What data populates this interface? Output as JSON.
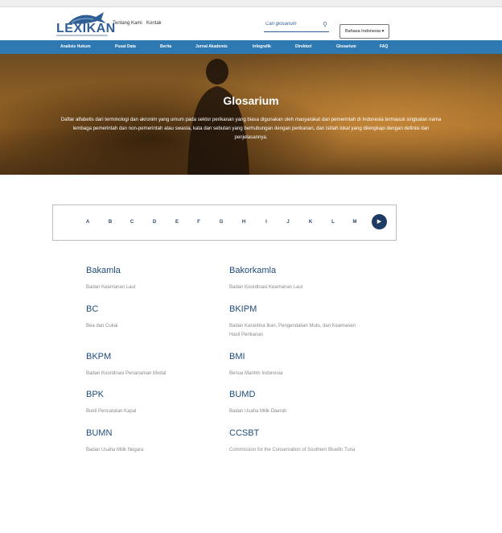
{
  "header": {
    "logo_text": "LEXIKAN",
    "links": [
      "Tentang Kami",
      "Kontak"
    ],
    "search_placeholder": "Cari glosarium",
    "language": "Bahasa Indonesia ▾"
  },
  "nav": {
    "items": [
      "Analisis Hukum",
      "Pusat Data",
      "Berita",
      "Jurnal Akademis",
      "Infografik",
      "Direktori",
      "Glosarium",
      "FAQ"
    ]
  },
  "hero": {
    "title": "Glosarium",
    "description": "Daftar alfabetis dari terminologi dan akronim yang umum pada sektor perikanan yang biasa digunakan oleh masyarakat dan pemerintah di Indonesia termasuk singkatan nama lembaga pemerintah dan non-pemerintah atau swasta, kata dan sebutan yang berhubungan dengan perikanan, dan istilah lokal yang dilengkapi dengan definisi dan penjelasannya."
  },
  "alphabet": {
    "letters": [
      "A",
      "B",
      "C",
      "D",
      "E",
      "F",
      "G",
      "H",
      "I",
      "J",
      "K",
      "L",
      "M"
    ],
    "next_icon": "play-icon"
  },
  "glossary": [
    {
      "term": "Bakamla",
      "definition": "Badan Keamanan Laut"
    },
    {
      "term": "Bakorkamla",
      "definition": "Badan Koordinasi Keamanan Laut"
    },
    {
      "term": "BC",
      "definition": "Bea dan Cukai"
    },
    {
      "term": "BKIPM",
      "definition": "Badan Karantina Ikan, Pengendalian Mutu, dan Keamanan Hasil Perikanan"
    },
    {
      "term": "BKPM",
      "definition": "Badan Koordinasi Penanaman Modal"
    },
    {
      "term": "BMI",
      "definition": "Benua Maritim Indonesia"
    },
    {
      "term": "BPK",
      "definition": "Bukti Pencatatan Kapal"
    },
    {
      "term": "BUMD",
      "definition": "Badan Usaha Milik Daerah"
    },
    {
      "term": "BUMN",
      "definition": "Badan Usaha Milik Negara"
    },
    {
      "term": "CCSBT",
      "definition": "Commission for the Conservation of Southern Bluefin Tuna"
    }
  ],
  "colors": {
    "nav": "#2e79b1",
    "term": "#1f4c7a",
    "next_button": "#1e3b66"
  }
}
